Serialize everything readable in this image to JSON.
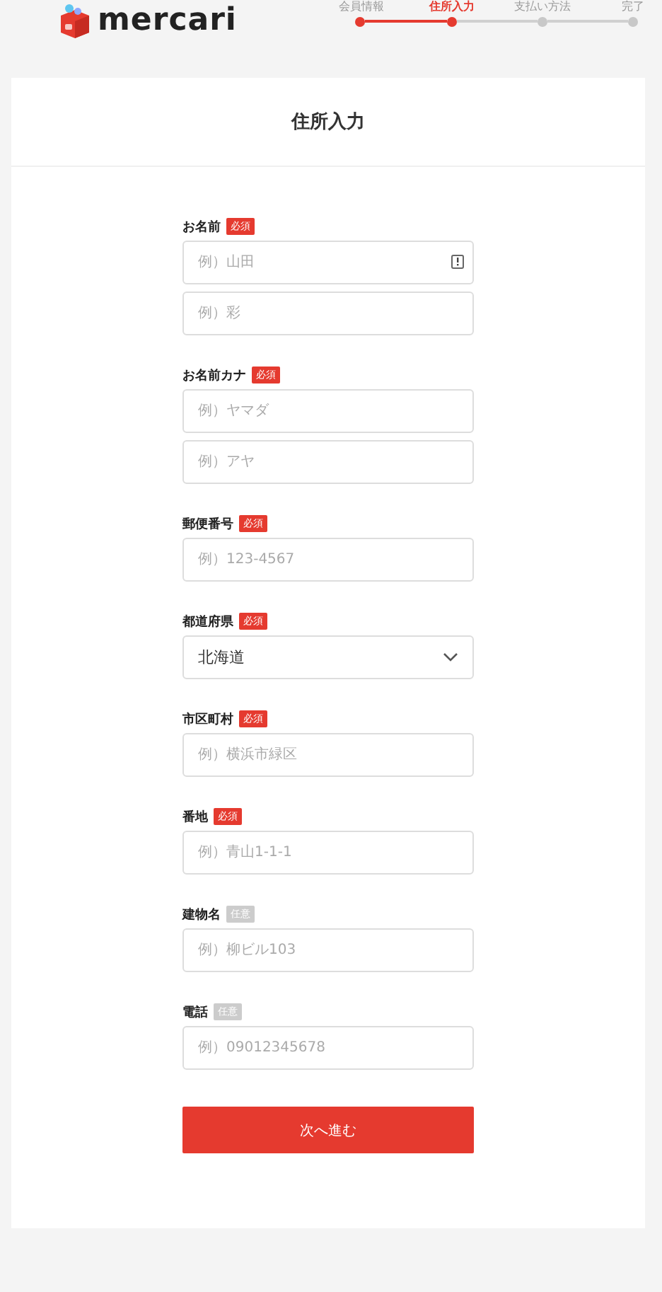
{
  "header": {
    "logo_text": "mercari"
  },
  "steps": [
    {
      "label": "会員情報",
      "done": true,
      "selected": false
    },
    {
      "label": "住所入力",
      "done": true,
      "selected": true
    },
    {
      "label": "支払い方法",
      "done": false,
      "selected": false
    },
    {
      "label": "完了",
      "done": false,
      "selected": false
    }
  ],
  "title": "住所入力",
  "fields": [
    {
      "label": "お名前",
      "badge": "必須",
      "required": true,
      "inputs": [
        {
          "kind": "text",
          "placeholder": "例）山田",
          "autofill_icon": true
        },
        {
          "kind": "text",
          "placeholder": "例）彩",
          "autofill_icon": false
        }
      ]
    },
    {
      "label": "お名前カナ",
      "badge": "必須",
      "required": true,
      "inputs": [
        {
          "kind": "text",
          "placeholder": "例）ヤマダ",
          "autofill_icon": false
        },
        {
          "kind": "text",
          "placeholder": "例）アヤ",
          "autofill_icon": false
        }
      ]
    },
    {
      "label": "郵便番号",
      "badge": "必須",
      "required": true,
      "inputs": [
        {
          "kind": "text",
          "placeholder": "例）123-4567",
          "autofill_icon": false
        }
      ]
    },
    {
      "label": "都道府県",
      "badge": "必須",
      "required": true,
      "inputs": [
        {
          "kind": "select",
          "value": "北海道"
        }
      ]
    },
    {
      "label": "市区町村",
      "badge": "必須",
      "required": true,
      "inputs": [
        {
          "kind": "text",
          "placeholder": "例）横浜市緑区",
          "autofill_icon": false
        }
      ]
    },
    {
      "label": "番地",
      "badge": "必須",
      "required": true,
      "inputs": [
        {
          "kind": "text",
          "placeholder": "例）青山1-1-1",
          "autofill_icon": false
        }
      ]
    },
    {
      "label": "建物名",
      "badge": "任意",
      "required": false,
      "inputs": [
        {
          "kind": "text",
          "placeholder": "例）柳ビル103",
          "autofill_icon": false
        }
      ]
    },
    {
      "label": "電話",
      "badge": "任意",
      "required": false,
      "inputs": [
        {
          "kind": "text",
          "placeholder": "例）09012345678",
          "autofill_icon": false
        }
      ]
    }
  ],
  "submit": "次へ進む"
}
